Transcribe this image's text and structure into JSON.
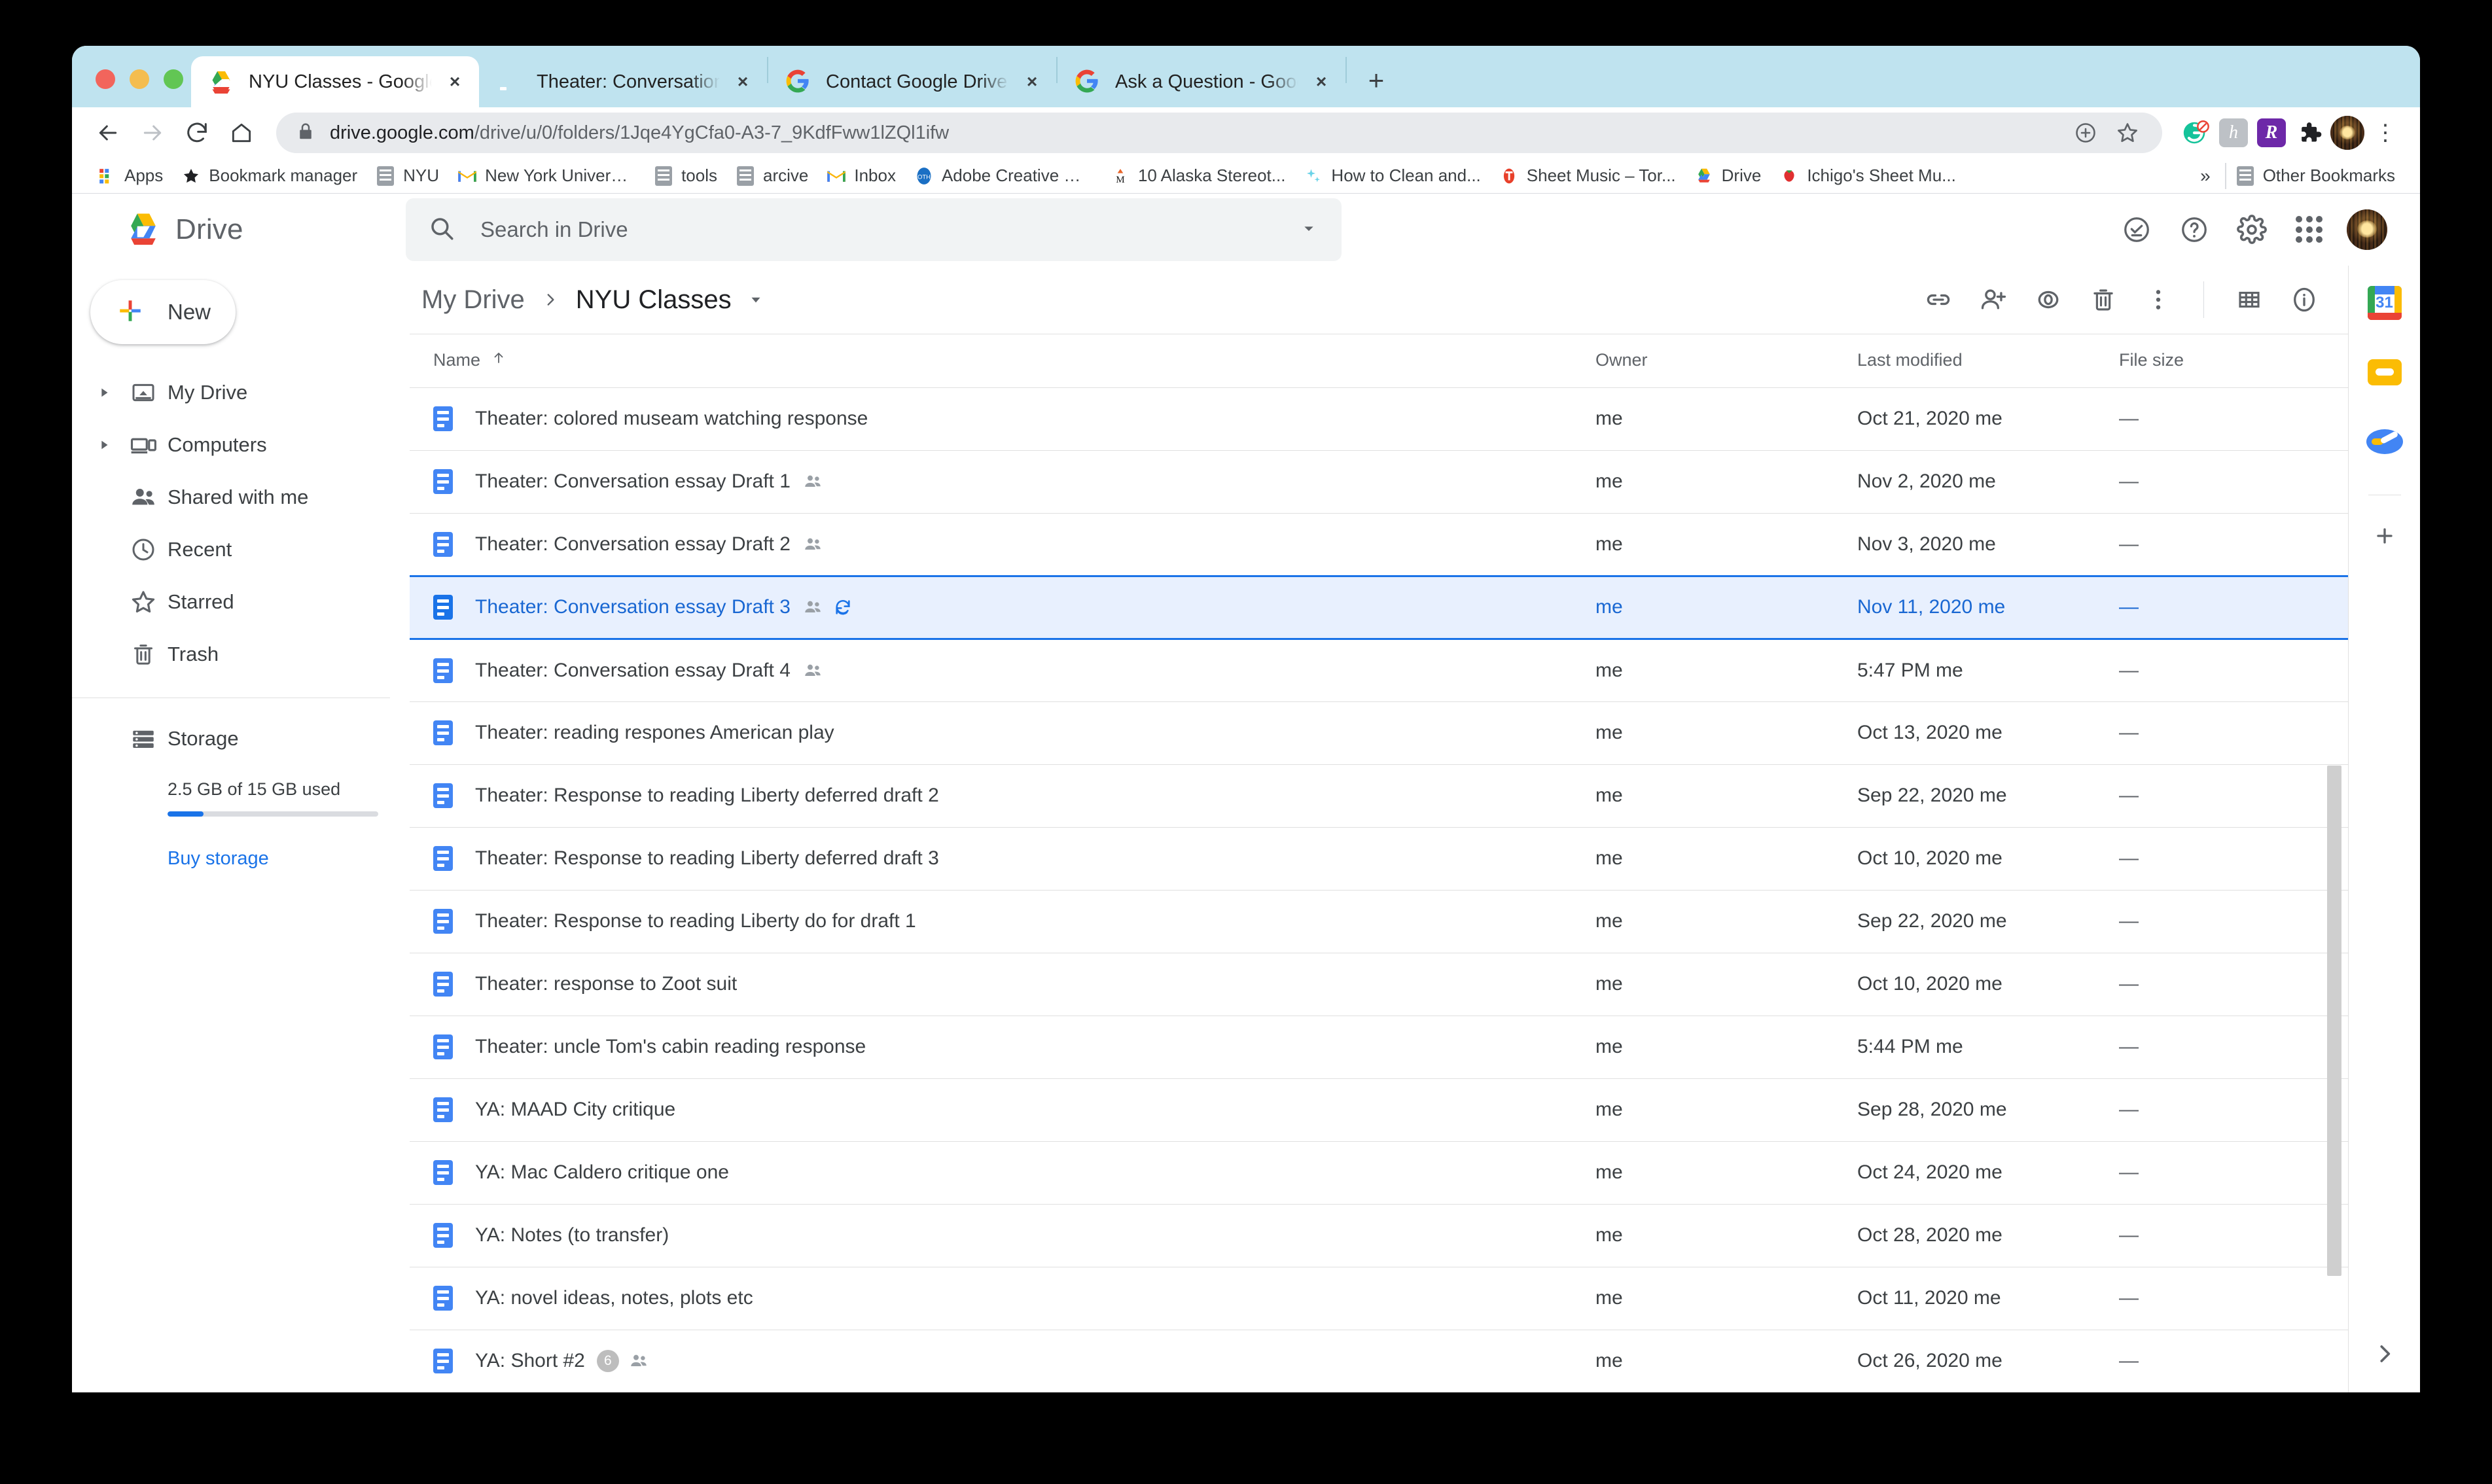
{
  "browser": {
    "tabs": [
      {
        "title": "NYU Classes - Google Drive",
        "favicon": "drive-icon",
        "active": true
      },
      {
        "title": "Theater: Conversation essay D",
        "favicon": "docs-icon",
        "active": false
      },
      {
        "title": "Contact Google Drive support",
        "favicon": "google-icon",
        "active": false
      },
      {
        "title": "Ask a Question - Google Drive",
        "favicon": "google-icon",
        "active": false
      }
    ],
    "new_tab_label": "+",
    "close_label": "×",
    "url_domain": "drive.google.com",
    "url_path": "/drive/u/0/folders/1Jqe4YgCfa0-A3-7_9KdfFww1lZQl1ifw",
    "nav": {
      "back": "back-icon",
      "forward": "forward-icon",
      "reload": "reload-icon",
      "home": "home-icon"
    },
    "omnibox_icons": [
      "add-to-collection-icon",
      "bookmark-star-icon"
    ],
    "extensions": [
      "grammarly-extension-icon",
      "hypothesis-extension-icon",
      "rakuten-extension-icon",
      "puzzle-extensions-icon"
    ],
    "menu_label": "⋮",
    "bookmarks": [
      {
        "label": "Apps",
        "icon": "apps-grid-icon"
      },
      {
        "label": "Bookmark manager",
        "icon": "star-icon"
      },
      {
        "label": "NYU",
        "icon": "folder-icon"
      },
      {
        "label": "New York Universi...",
        "icon": "gmail-icon"
      },
      {
        "label": "tools",
        "icon": "folder-icon"
      },
      {
        "label": "arcive",
        "icon": "folder-icon"
      },
      {
        "label": "Inbox",
        "icon": "gmail-icon"
      },
      {
        "label": "Adobe Creative Cl...",
        "icon": "adobe-icon"
      },
      {
        "label": "10 Alaska Stereot...",
        "icon": "medium-icon"
      },
      {
        "label": "How to Clean and...",
        "icon": "sparkle-icon"
      },
      {
        "label": "Sheet Music – Tor...",
        "icon": "musescore-icon"
      },
      {
        "label": "Drive",
        "icon": "drive-icon"
      },
      {
        "label": "Ichigo's Sheet Mu...",
        "icon": "ichigo-icon"
      }
    ],
    "bookmarks_overflow": "»",
    "other_bookmarks": {
      "label": "Other Bookmarks",
      "icon": "folder-icon"
    }
  },
  "drive": {
    "logo_text": "Drive",
    "search": {
      "placeholder": "Search in Drive",
      "icon": "search-icon",
      "options_icon": "chevron-down-icon"
    },
    "header_actions": [
      {
        "name": "support-icon",
        "title": "Support"
      },
      {
        "name": "help-icon",
        "title": "Help"
      },
      {
        "name": "settings-gear-icon",
        "title": "Settings"
      },
      {
        "name": "google-apps-icon",
        "title": "Google apps"
      },
      {
        "name": "account-avatar",
        "title": "Account"
      }
    ],
    "new_button": {
      "label": "New",
      "icon": "plus-icon"
    },
    "nav_items": [
      {
        "label": "My Drive",
        "icon": "my-drive-icon",
        "expandable": true
      },
      {
        "label": "Computers",
        "icon": "computers-icon",
        "expandable": true
      },
      {
        "label": "Shared with me",
        "icon": "shared-with-me-icon",
        "expandable": false
      },
      {
        "label": "Recent",
        "icon": "recent-clock-icon",
        "expandable": false
      },
      {
        "label": "Starred",
        "icon": "star-outline-icon",
        "expandable": false
      },
      {
        "label": "Trash",
        "icon": "trash-icon",
        "expandable": false
      }
    ],
    "storage": {
      "label": "Storage",
      "icon": "storage-icon",
      "usage_text": "2.5 GB of 15 GB used",
      "percent": 17,
      "buy_label": "Buy storage"
    },
    "breadcrumb": {
      "root": "My Drive",
      "separator": "›",
      "current": "NYU Classes",
      "caret": "dropdown-caret-icon"
    },
    "toolbar_actions": [
      {
        "name": "get-link-icon"
      },
      {
        "name": "add-person-icon"
      },
      {
        "name": "preview-eye-icon"
      },
      {
        "name": "remove-trash-icon"
      },
      {
        "name": "more-options-icon"
      },
      {
        "name": "grid-view-icon"
      },
      {
        "name": "details-info-icon"
      }
    ],
    "columns": {
      "name": "Name",
      "sort_icon": "sort-ascending-arrow",
      "owner": "Owner",
      "modified": "Last modified",
      "size": "File size"
    },
    "files": [
      {
        "name": "Theater: colored museam watching response",
        "owner": "me",
        "modified": "Oct 21, 2020",
        "modified_by": "me",
        "size": "—",
        "shared": false,
        "synced": false,
        "count": null,
        "selected": false
      },
      {
        "name": "Theater: Conversation essay Draft 1",
        "owner": "me",
        "modified": "Nov 2, 2020",
        "modified_by": "me",
        "size": "—",
        "shared": true,
        "synced": false,
        "count": null,
        "selected": false
      },
      {
        "name": "Theater: Conversation essay Draft 2",
        "owner": "me",
        "modified": "Nov 3, 2020",
        "modified_by": "me",
        "size": "—",
        "shared": true,
        "synced": false,
        "count": null,
        "selected": false
      },
      {
        "name": "Theater: Conversation essay Draft 3",
        "owner": "me",
        "modified": "Nov 11, 2020",
        "modified_by": "me",
        "size": "—",
        "shared": true,
        "synced": true,
        "count": null,
        "selected": true
      },
      {
        "name": "Theater: Conversation essay Draft 4",
        "owner": "me",
        "modified": "5:47 PM",
        "modified_by": "me",
        "size": "—",
        "shared": true,
        "synced": false,
        "count": null,
        "selected": false
      },
      {
        "name": "Theater: reading respones American play",
        "owner": "me",
        "modified": "Oct 13, 2020",
        "modified_by": "me",
        "size": "—",
        "shared": false,
        "synced": false,
        "count": null,
        "selected": false
      },
      {
        "name": "Theater: Response to reading Liberty deferred draft 2",
        "owner": "me",
        "modified": "Sep 22, 2020",
        "modified_by": "me",
        "size": "—",
        "shared": false,
        "synced": false,
        "count": null,
        "selected": false
      },
      {
        "name": "Theater: Response to reading Liberty deferred draft 3",
        "owner": "me",
        "modified": "Oct 10, 2020",
        "modified_by": "me",
        "size": "—",
        "shared": false,
        "synced": false,
        "count": null,
        "selected": false
      },
      {
        "name": "Theater: Response to reading Liberty do for draft 1",
        "owner": "me",
        "modified": "Sep 22, 2020",
        "modified_by": "me",
        "size": "—",
        "shared": false,
        "synced": false,
        "count": null,
        "selected": false
      },
      {
        "name": "Theater: response to Zoot suit",
        "owner": "me",
        "modified": "Oct 10, 2020",
        "modified_by": "me",
        "size": "—",
        "shared": false,
        "synced": false,
        "count": null,
        "selected": false
      },
      {
        "name": "Theater: uncle Tom's cabin reading response",
        "owner": "me",
        "modified": "5:44 PM",
        "modified_by": "me",
        "size": "—",
        "shared": false,
        "synced": false,
        "count": null,
        "selected": false
      },
      {
        "name": "YA: MAAD City critique",
        "owner": "me",
        "modified": "Sep 28, 2020",
        "modified_by": "me",
        "size": "—",
        "shared": false,
        "synced": false,
        "count": null,
        "selected": false
      },
      {
        "name": "YA: Mac Caldero critique one",
        "owner": "me",
        "modified": "Oct 24, 2020",
        "modified_by": "me",
        "size": "—",
        "shared": false,
        "synced": false,
        "count": null,
        "selected": false
      },
      {
        "name": "YA: Notes (to transfer)",
        "owner": "me",
        "modified": "Oct 28, 2020",
        "modified_by": "me",
        "size": "—",
        "shared": false,
        "synced": false,
        "count": null,
        "selected": false
      },
      {
        "name": "YA: novel ideas, notes, plots etc",
        "owner": "me",
        "modified": "Oct 11, 2020",
        "modified_by": "me",
        "size": "—",
        "shared": false,
        "synced": false,
        "count": null,
        "selected": false
      },
      {
        "name": "YA: Short #2",
        "owner": "me",
        "modified": "Oct 26, 2020",
        "modified_by": "me",
        "size": "—",
        "shared": true,
        "synced": false,
        "count": "6",
        "selected": false
      }
    ],
    "side_apps": [
      {
        "name": "google-calendar-icon",
        "day": "31"
      },
      {
        "name": "google-keep-icon"
      },
      {
        "name": "google-tasks-icon"
      }
    ],
    "side_add": "plus-icon",
    "side_expand": "expand-panel-icon"
  },
  "colors": {
    "accent": "#1a73e8",
    "selected_row": "#e8f0fe",
    "tabstrip": "#bfe3ef",
    "text": "#3c4043",
    "muted": "#5f6368"
  }
}
